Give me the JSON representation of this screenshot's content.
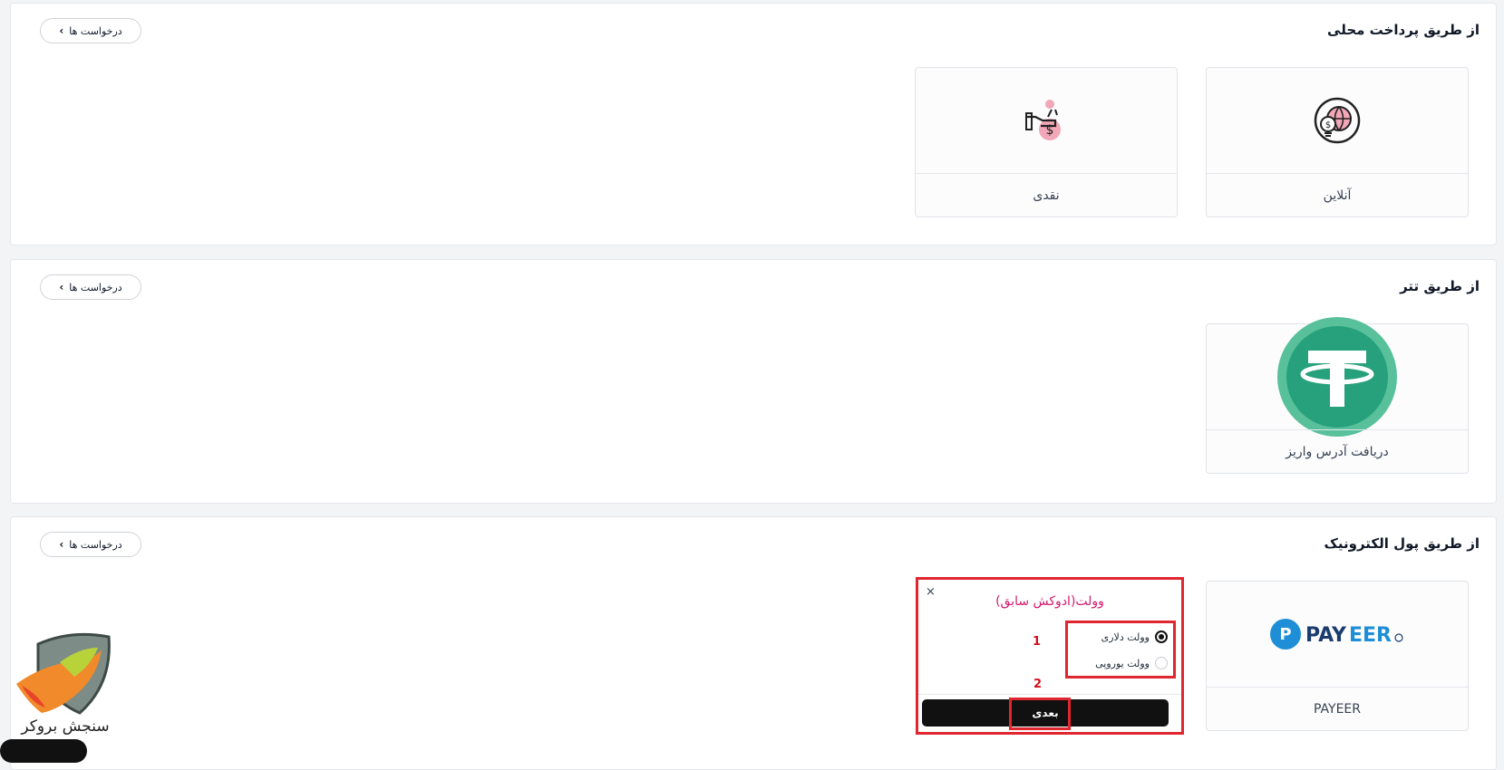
{
  "request_button_label": "درخواست ها",
  "sections": [
    {
      "title": "از طریق پرداخت محلی",
      "cards": [
        {
          "label": "آنلاین",
          "icon": "online-payment-globe-icon"
        },
        {
          "label": "نقدی",
          "icon": "cash-money-hand-icon"
        }
      ]
    },
    {
      "title": "از طریق تتر",
      "cards": [
        {
          "label": "دریافت آدرس واریز",
          "icon": "tether-usdt-icon"
        }
      ]
    },
    {
      "title": "از طریق پول الکترونیک",
      "cards": [
        {
          "label": "PAYEER",
          "icon": "payeer-logo",
          "logo_text_pay": "PAY",
          "logo_text_eer": "EER"
        }
      ]
    }
  ],
  "modal": {
    "title": "وولت(ادوکش سابق)",
    "close": "×",
    "options": [
      {
        "label": "وولت دلاری",
        "selected": true
      },
      {
        "label": "وولت یوروپی",
        "selected": false
      }
    ],
    "next_label": "بعدی",
    "annotation_1": "1",
    "annotation_2": "2"
  },
  "logo_text": "سنجش بروکر",
  "colors": {
    "highlight": "#e0262f",
    "modal_title": "#d61a6e",
    "tether": "#26a17b",
    "payeer_blue": "#1e8fd6"
  }
}
